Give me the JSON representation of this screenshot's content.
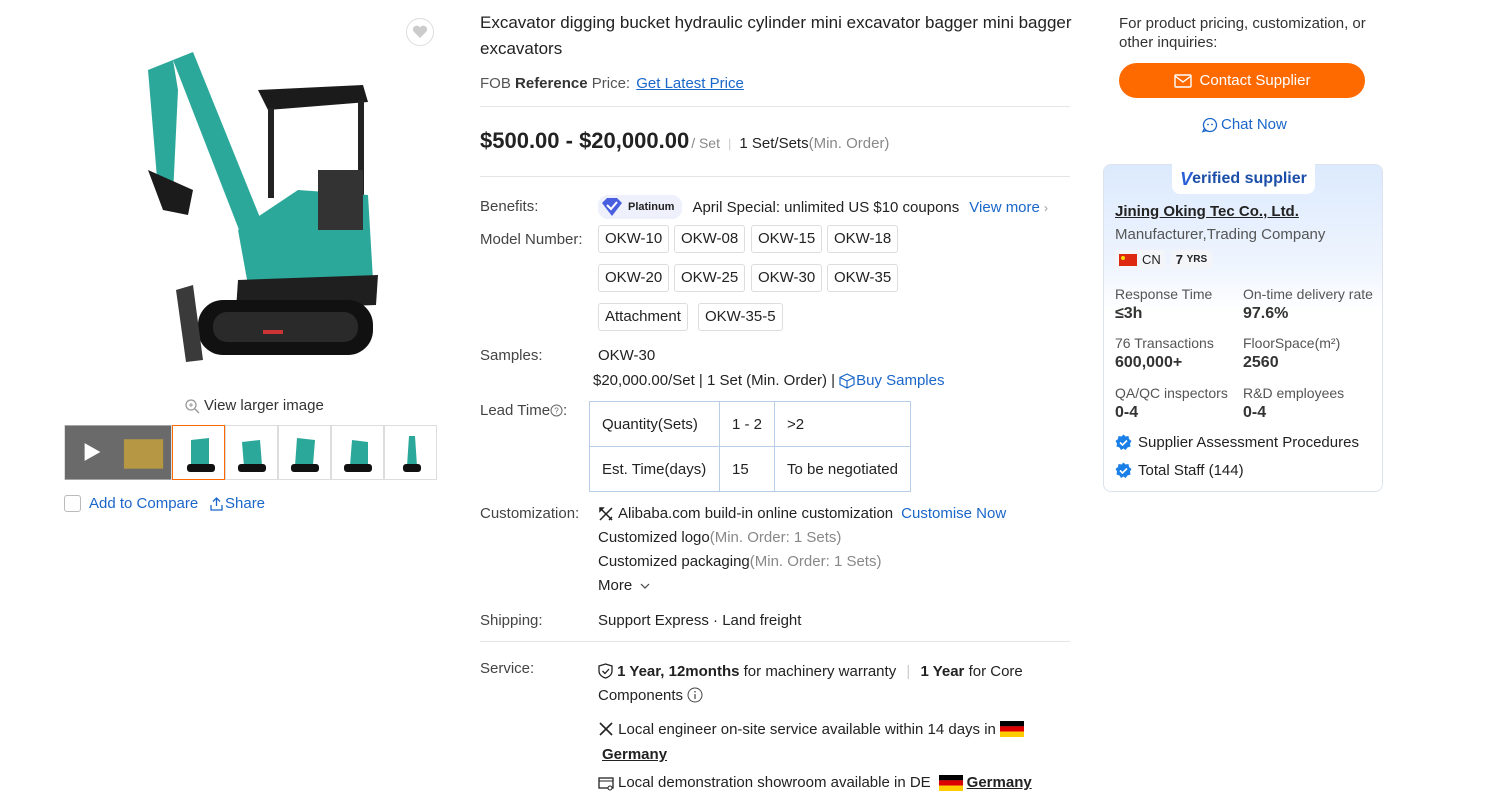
{
  "product": {
    "title": "Excavator digging bucket hydraulic cylinder mini excavator bagger mini bagger excavators",
    "fob_prefix": "FOB",
    "fob_reference": "Reference",
    "fob_price_label": "Price:",
    "get_latest_price": "Get Latest Price",
    "price": "$500.00 - $20,000.00",
    "price_unit": "/ Set",
    "min_order_qty": "1 Set/Sets",
    "min_order_label": "(Min. Order)"
  },
  "gallery": {
    "view_larger": "View larger image",
    "add_to_compare": "Add to Compare",
    "share": "Share"
  },
  "benefits": {
    "label": "Benefits:",
    "badge": "Platinum",
    "text": "April Special: unlimited US $10 coupons",
    "view_more": "View more"
  },
  "model": {
    "label": "Model Number:",
    "options": [
      "OKW-10",
      "OKW-08",
      "OKW-15",
      "OKW-18",
      "OKW-20",
      "OKW-25",
      "OKW-30",
      "OKW-35",
      "Attachment",
      "OKW-35-5"
    ]
  },
  "samples": {
    "label": "Samples:",
    "model": "OKW-30",
    "detail": "$20,000.00/Set | 1 Set (Min. Order) |",
    "buy": "Buy Samples"
  },
  "lead_time": {
    "label": "Lead Time",
    "colon": ":",
    "rows": [
      [
        "Quantity(Sets)",
        "1 - 2",
        ">2"
      ],
      [
        "Est. Time(days)",
        "15",
        "To be negotiated"
      ]
    ]
  },
  "customization": {
    "label": "Customization:",
    "online": "Alibaba.com build-in online customization",
    "customise_now": "Customise Now",
    "logo": "Customized logo",
    "logo_min": "(Min. Order: 1 Sets)",
    "packaging": "Customized packaging",
    "packaging_min": "(Min. Order: 1 Sets)",
    "more": "More"
  },
  "shipping": {
    "label": "Shipping:",
    "text": "Support Express · Land freight"
  },
  "service": {
    "label": "Service:",
    "warranty_bold": "1 Year, 12months",
    "warranty_text": "for machinery warranty",
    "core_bold": "1 Year",
    "core_text": "for Core",
    "core_text2": "Components",
    "engineer": "Local engineer on-site service available within 14 days in",
    "engineer_country": "Germany",
    "showroom": "Local demonstration showroom available in DE",
    "showroom_country": "Germany"
  },
  "sidebar": {
    "inquiry": "For product pricing, customization, or other inquiries:",
    "contact": "Contact Supplier",
    "chat": "Chat Now"
  },
  "supplier": {
    "verified": "erified supplier",
    "verified_v": "V",
    "name": "Jining Oking Tec Co., Ltd.",
    "type": "Manufacturer,Trading Company",
    "country": "CN",
    "years": "7",
    "years_unit": "YRS",
    "stats": [
      {
        "label": "Response Time",
        "value": "≤3h"
      },
      {
        "label": "On-time delivery rate",
        "value": "97.6%"
      },
      {
        "label": "76 Transactions",
        "value": "600,000+"
      },
      {
        "label": "FloorSpace(m²)",
        "value": "2560"
      },
      {
        "label": "QA/QC inspectors",
        "value": "0-4"
      },
      {
        "label": "R&D employees",
        "value": "0-4"
      }
    ],
    "assessment": "Supplier Assessment Procedures",
    "staff": "Total Staff (144)"
  },
  "colors": {
    "accent": "#ff6a00",
    "link": "#1a66c9"
  }
}
